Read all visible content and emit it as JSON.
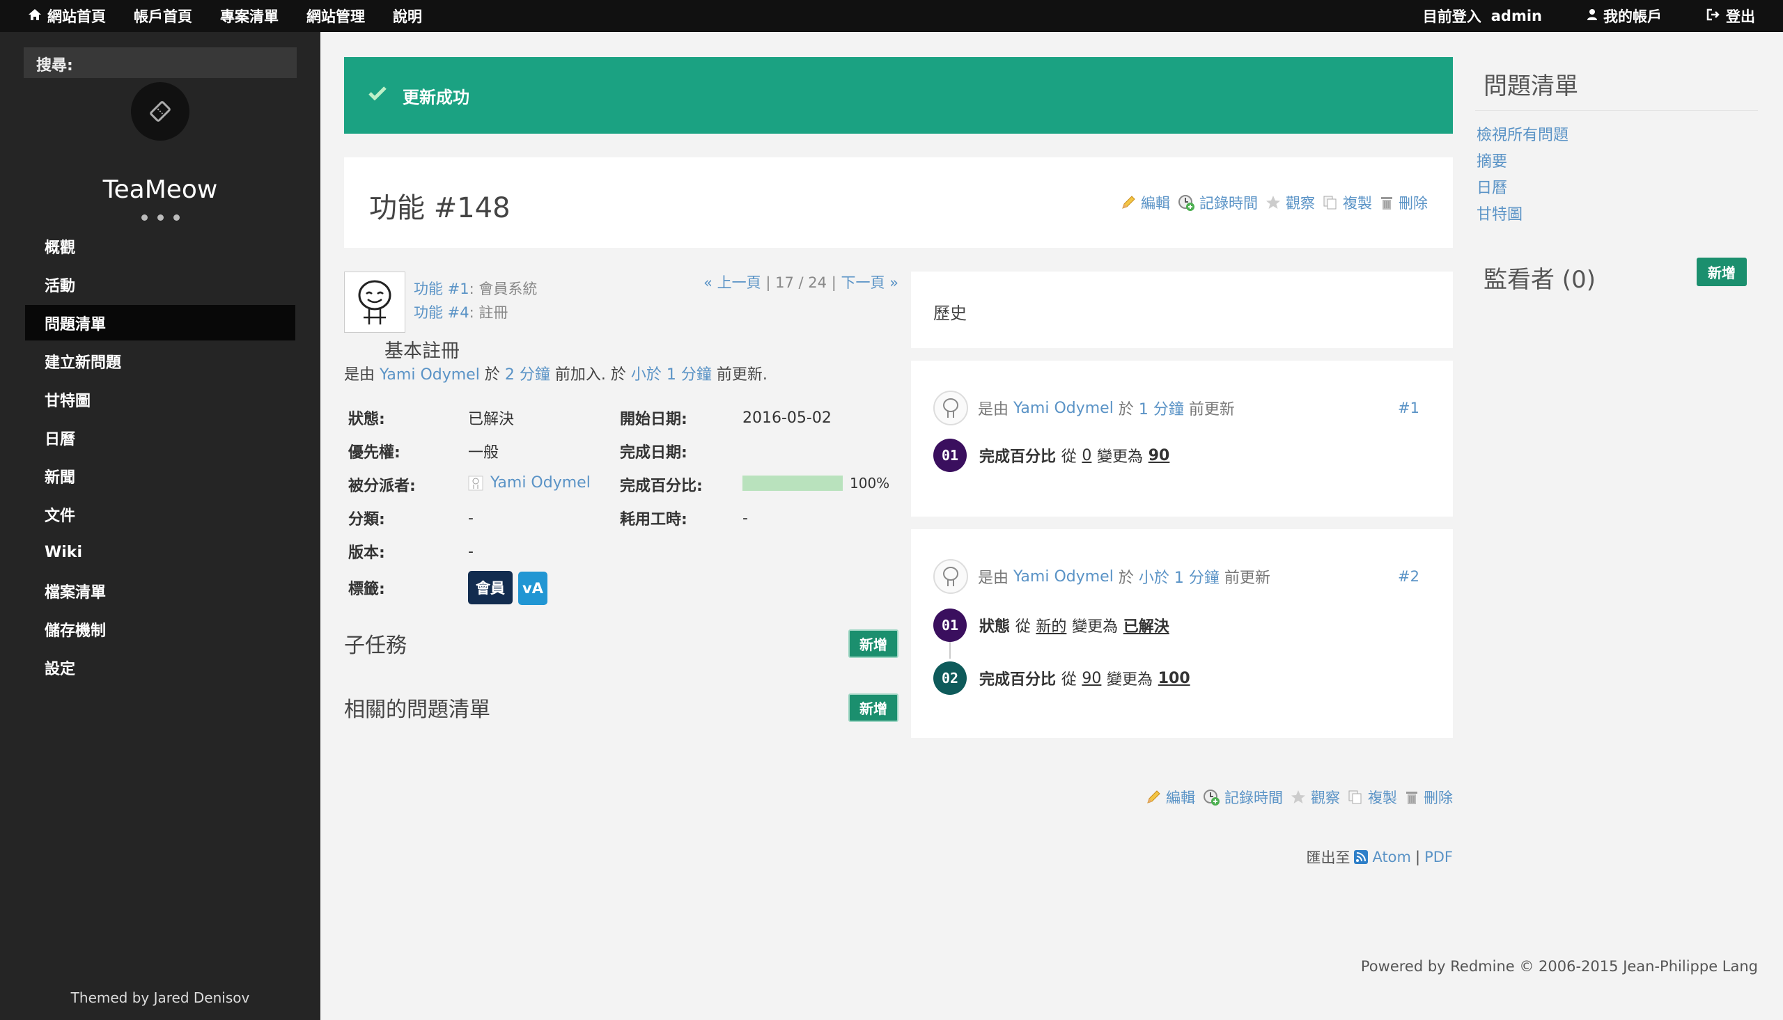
{
  "topbar": {
    "home": "網站首頁",
    "my_page": "帳戶首頁",
    "projects": "專案清單",
    "administration": "網站管理",
    "help": "說明",
    "logged_in_as": "目前登入",
    "username": "admin",
    "my_account": "我的帳戶",
    "sign_out": "登出"
  },
  "sidebar": {
    "search_label": "搜尋:",
    "brand": "TeaMeow",
    "menu": [
      {
        "label": "概觀"
      },
      {
        "label": "活動"
      },
      {
        "label": "問題清單",
        "active": true
      },
      {
        "label": "建立新問題"
      },
      {
        "label": "甘特圖"
      },
      {
        "label": "日曆"
      },
      {
        "label": "新聞"
      },
      {
        "label": "文件"
      },
      {
        "label": "Wiki"
      },
      {
        "label": "檔案清單"
      },
      {
        "label": "儲存機制"
      },
      {
        "label": "設定"
      }
    ],
    "credit": "Themed by Jared Denisov"
  },
  "flash": {
    "message": "更新成功"
  },
  "issue": {
    "title": "功能 #148",
    "actions": {
      "edit": "編輯",
      "log_time": "記錄時間",
      "watch": "觀察",
      "copy": "複製",
      "delete": "刪除"
    },
    "parents": [
      {
        "link": "功能 #1",
        "sep": ":",
        "name": "會員系統"
      },
      {
        "link": "功能 #4",
        "sep": ":",
        "name": "註冊"
      }
    ],
    "pager": {
      "prev": "« 上一頁",
      "sep1": "|",
      "position": "17 / 24",
      "sep2": "|",
      "next": "下一頁 »"
    },
    "subject": "基本註冊",
    "byline": {
      "prefix": "是由",
      "author": "Yami Odymel",
      "at": "於",
      "added_time": "2 分鐘",
      "added": "前加入.",
      "at2": "於",
      "updated_time": "小於 1 分鐘",
      "updated": "前更新."
    },
    "fields": {
      "status_label": "狀態:",
      "status": "已解決",
      "start_label": "開始日期:",
      "start": "2016-05-02",
      "priority_label": "優先權:",
      "priority": "一般",
      "due_label": "完成日期:",
      "due": "",
      "assignee_label": "被分派者:",
      "assignee": "Yami Odymel",
      "done_label": "完成百分比:",
      "done_text": "100%",
      "done_ratio": 1.0,
      "category_label": "分類:",
      "category": "-",
      "spent_label": "耗用工時:",
      "spent": "-",
      "version_label": "版本:",
      "version": "-",
      "tags_label": "標籤:"
    },
    "tags": [
      {
        "label": "會員",
        "color": "#122c4f"
      },
      {
        "label": "vA",
        "color": "#2196d3"
      }
    ],
    "subtasks": "子任務",
    "relations": "相關的問題清單",
    "add": "新增"
  },
  "history": {
    "title": "歷史",
    "journals": [
      {
        "prefix": "是由",
        "author": "Yami Odymel",
        "at": "於",
        "time": "1 分鐘",
        "suffix": "前更新",
        "number": "#1",
        "details": [
          {
            "badge": "01",
            "color": "#3a0f5e",
            "field": "完成百分比",
            "from_word": "從",
            "old": "0",
            "to_word": "變更為",
            "new": "90"
          }
        ]
      },
      {
        "prefix": "是由",
        "author": "Yami Odymel",
        "at": "於",
        "time": "小於 1 分鐘",
        "suffix": "前更新",
        "number": "#2",
        "details": [
          {
            "badge": "01",
            "color": "#3a0f5e",
            "field": "狀態",
            "from_word": "從",
            "old": "新的",
            "to_word": "變更為",
            "new": "已解決"
          },
          {
            "badge": "02",
            "color": "#0e5a5a",
            "field": "完成百分比",
            "from_word": "從",
            "old": "90",
            "to_word": "變更為",
            "new": "100"
          }
        ]
      }
    ]
  },
  "export": {
    "label": "匯出至",
    "atom": "Atom",
    "sep": "|",
    "pdf": "PDF"
  },
  "footer": {
    "powered": "Powered by Redmine © 2006-2015 Jean-Philippe Lang"
  },
  "right_sidebar": {
    "issues_title": "問題清單",
    "links": [
      "檢視所有問題",
      "摘要",
      "日曆",
      "甘特圖"
    ],
    "watchers_title": "監看者 (0)",
    "add": "新增"
  },
  "colors": {
    "accent": "#1ba282",
    "link": "#5a93c6",
    "sidebar": "#252525",
    "topbar": "#111111"
  }
}
